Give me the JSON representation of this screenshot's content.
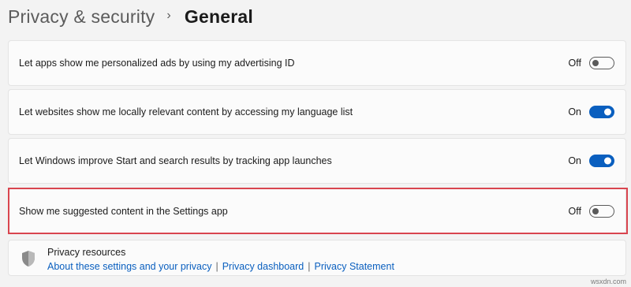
{
  "breadcrumb": {
    "parent": "Privacy & security",
    "separator": "›",
    "current": "General"
  },
  "settings": [
    {
      "label": "Let apps show me personalized ads by using my advertising ID",
      "state": "Off",
      "on": false
    },
    {
      "label": "Let websites show me locally relevant content by accessing my language list",
      "state": "On",
      "on": true
    },
    {
      "label": "Let Windows improve Start and search results by tracking app launches",
      "state": "On",
      "on": true
    },
    {
      "label": "Show me suggested content in the Settings app",
      "state": "Off",
      "on": false
    }
  ],
  "resources": {
    "icon": "shield-icon",
    "title": "Privacy resources",
    "links": [
      "About these settings and your privacy",
      "Privacy dashboard",
      "Privacy Statement"
    ],
    "separator": "|"
  },
  "watermark": "wsxdn.com",
  "colors": {
    "accent": "#0a5fbf",
    "highlight": "#d9454f",
    "background": "#f3f3f3",
    "card": "#fbfbfb"
  }
}
